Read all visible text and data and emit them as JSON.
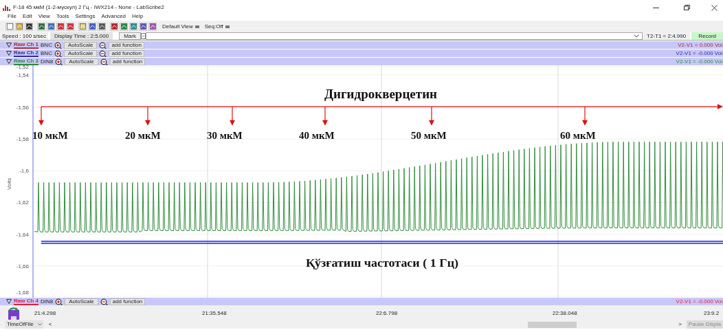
{
  "window": {
    "title": "F-18 45 мкМ (1-2-мускул) 2 Гц - IWX214 - None - LabScribe2"
  },
  "menu": [
    "File",
    "Edit",
    "View",
    "Tools",
    "Settings",
    "Advanced",
    "Help"
  ],
  "toolbar": {
    "views": [
      "Default View",
      "Seq:Off"
    ]
  },
  "speed": "Speed : 100 s/sec",
  "display_time": "Display Time : 2:5.000",
  "mark_button": "Mark",
  "t2_t1": "T2-T1 = 2:4.990",
  "record_button": "Record",
  "channels": [
    {
      "name": "Raw Ch 1",
      "input": "BNC",
      "autoscale": "AutoScale",
      "function": "add function",
      "reading": "V2-V1 = 0.000 Vol",
      "color": "#a02c3c"
    },
    {
      "name": "Raw Ch 2",
      "input": "BNC",
      "autoscale": "AutoScale",
      "function": "add function",
      "reading": "V2-V1 = -0.000 Vol",
      "color": "#2a2ea0"
    },
    {
      "name": "Raw Ch 3",
      "input": "DIN8",
      "autoscale": "AutoScale",
      "function": "add function",
      "reading": "V2-V1 = -0.000 Vol",
      "color": "#2a8a3c"
    }
  ],
  "plot": {
    "ylabel": "Volts",
    "yticks": [
      "-1,52",
      "-1,54",
      "-1,56",
      "-1,58",
      "-1,6",
      "-1,62",
      "-1,64",
      "-1,66",
      "-1,68"
    ],
    "title": "Дигидрокверцетин",
    "doses": [
      "10 мкМ",
      "20 мкМ",
      "30 мкМ",
      "40 мкМ",
      "50 мкМ",
      "60 мкМ"
    ],
    "stimulus": "Қўзғатиш частотаси ( 1 Гц)"
  },
  "channel_4": {
    "name": "Raw Ch 4",
    "input": "DIN8",
    "autoscale": "AutoScale",
    "function": "add function",
    "reading": "V2-V1 = -0.000 Vol",
    "color": "#e0203c"
  },
  "time_ticks": [
    "21:4.298",
    "21:35.548",
    "22:6.798",
    "22:38.048",
    "23:9.2"
  ],
  "time_selector": "TimeOfFile",
  "scroll_left": "<",
  "scroll_right": ">",
  "pause_button": "Pause Displa"
}
